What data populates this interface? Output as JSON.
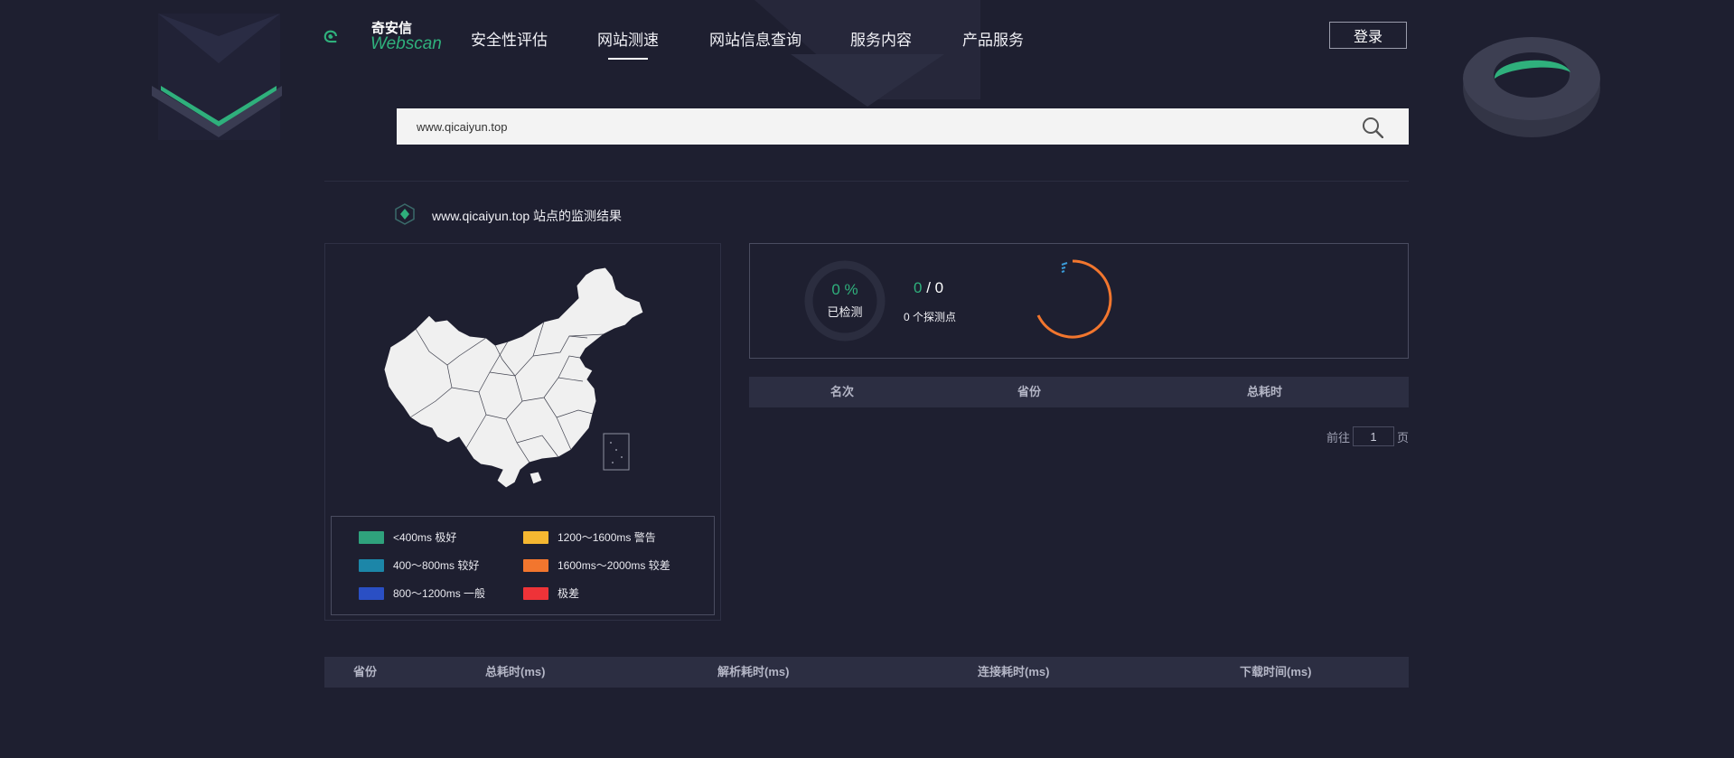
{
  "brand": {
    "name_cn": "奇安信",
    "name_en": "Webscan"
  },
  "nav": [
    {
      "label": "安全性评估",
      "active": false
    },
    {
      "label": "网站测速",
      "active": true
    },
    {
      "label": "网站信息查询",
      "active": false
    },
    {
      "label": "服务内容",
      "active": false
    },
    {
      "label": "产品服务",
      "active": false
    }
  ],
  "login_label": "登录",
  "search": {
    "value": "www.qicaiyun.top"
  },
  "result_title": "www.qicaiyun.top 站点的监测结果",
  "legend": [
    {
      "label": "<400ms 极好",
      "color": "#2fa27c"
    },
    {
      "label": "400～800ms 较好",
      "color": "#1c86a8"
    },
    {
      "label": "800～1200ms 一般",
      "color": "#2a4fc4"
    },
    {
      "label": "1200～1600ms 警告",
      "color": "#f5b731"
    },
    {
      "label": "1600ms～2000ms 较差",
      "color": "#f2762e"
    },
    {
      "label": "极差",
      "color": "#ee3338"
    }
  ],
  "stats": {
    "percent_text": "0 %",
    "percent_value": 0,
    "checked_label": "已检测",
    "done": "0",
    "separator": " / ",
    "total": "0",
    "probe_label": "0 个探测点"
  },
  "rank_table": {
    "headers": [
      "名次",
      "省份",
      "总耗时"
    ]
  },
  "pager": {
    "prefix": "前往",
    "page": "1",
    "suffix": "页"
  },
  "detail_table": {
    "headers": [
      "省份",
      "总耗时(ms)",
      "解析耗时(ms)",
      "连接耗时(ms)",
      "下载时间(ms)"
    ]
  },
  "colors": {
    "accent": "#2fb07c",
    "spinner": "#f2762e",
    "background": "#1e1f30"
  }
}
